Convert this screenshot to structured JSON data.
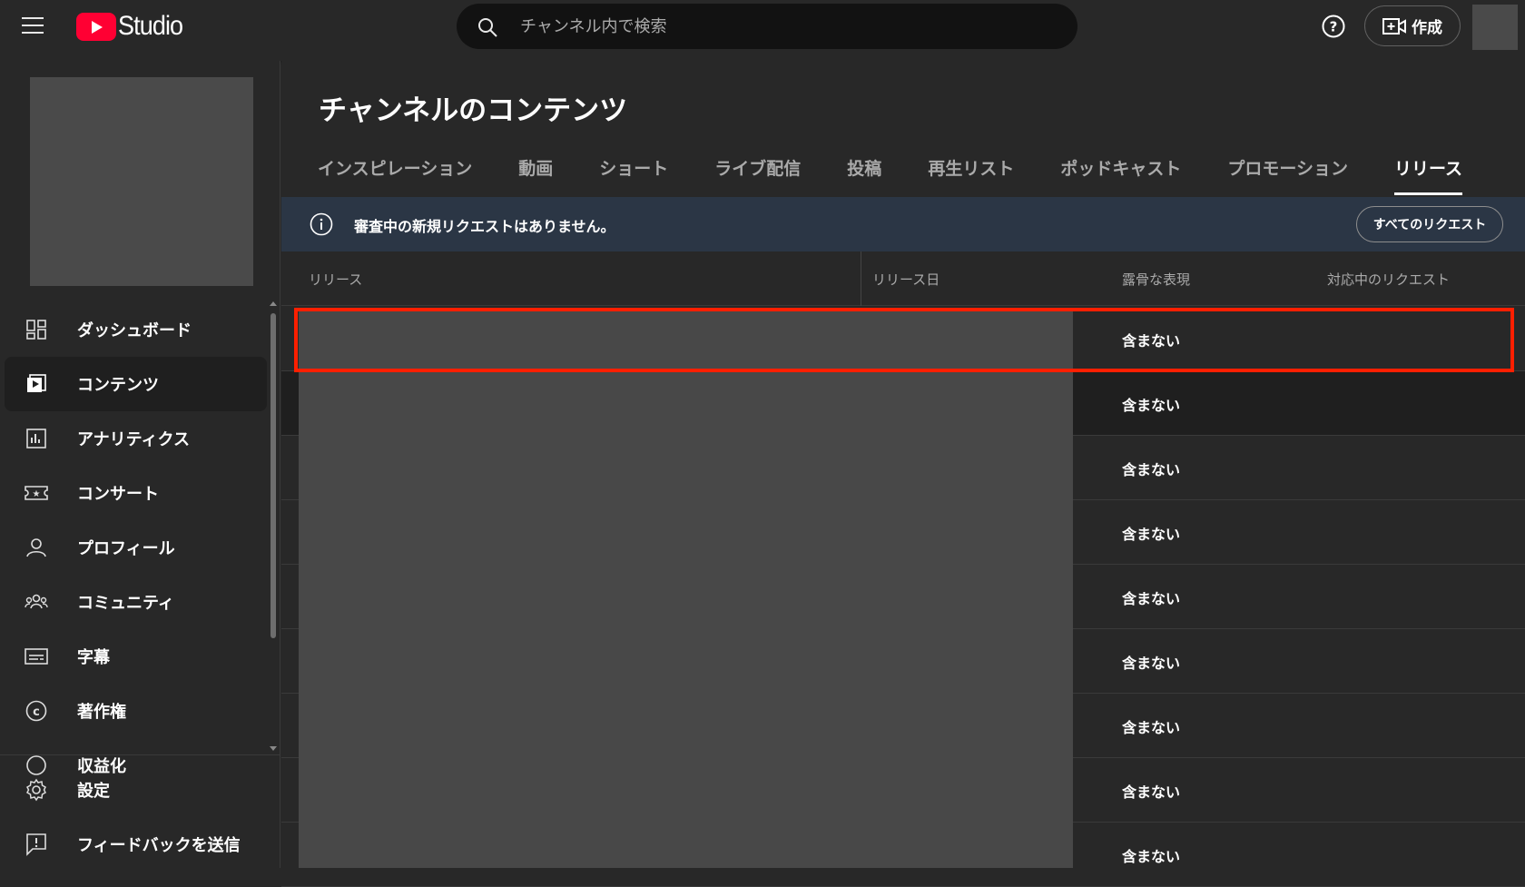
{
  "app": {
    "logo_text": "Studio"
  },
  "search": {
    "placeholder": "チャンネル内で検索"
  },
  "header": {
    "create_label": "作成"
  },
  "sidebar": {
    "items": [
      {
        "label": "ダッシュボード",
        "icon": "dashboard-icon"
      },
      {
        "label": "コンテンツ",
        "icon": "content-icon",
        "active": true
      },
      {
        "label": "アナリティクス",
        "icon": "analytics-icon"
      },
      {
        "label": "コンサート",
        "icon": "ticket-icon"
      },
      {
        "label": "プロフィール",
        "icon": "person-icon"
      },
      {
        "label": "コミュニティ",
        "icon": "community-icon"
      },
      {
        "label": "字幕",
        "icon": "subtitles-icon"
      },
      {
        "label": "著作権",
        "icon": "copyright-icon"
      },
      {
        "label": "収益化",
        "icon": "money-icon"
      }
    ],
    "bottom": [
      {
        "label": "設定",
        "icon": "gear-icon"
      },
      {
        "label": "フィードバックを送信",
        "icon": "feedback-icon"
      }
    ]
  },
  "main": {
    "title": "チャンネルのコンテンツ",
    "tabs": [
      "インスピレーション",
      "動画",
      "ショート",
      "ライブ配信",
      "投稿",
      "再生リスト",
      "ポッドキャスト",
      "プロモーション",
      "リリース"
    ],
    "active_tab": "リリース",
    "banner": {
      "message": "審査中の新規リクエストはありません。",
      "button": "すべてのリクエスト"
    },
    "table": {
      "headers": [
        "リリース",
        "リリース日",
        "露骨な表現",
        "対応中のリクエスト"
      ],
      "rows": [
        "含まない",
        "含まない",
        "含まない",
        "含まない",
        "含まない",
        "含まない",
        "含まない",
        "含まない",
        "含まない"
      ]
    }
  },
  "colors": {
    "accent": "#ff0033",
    "highlight": "#ff1f00",
    "banner": "#2b3645"
  }
}
